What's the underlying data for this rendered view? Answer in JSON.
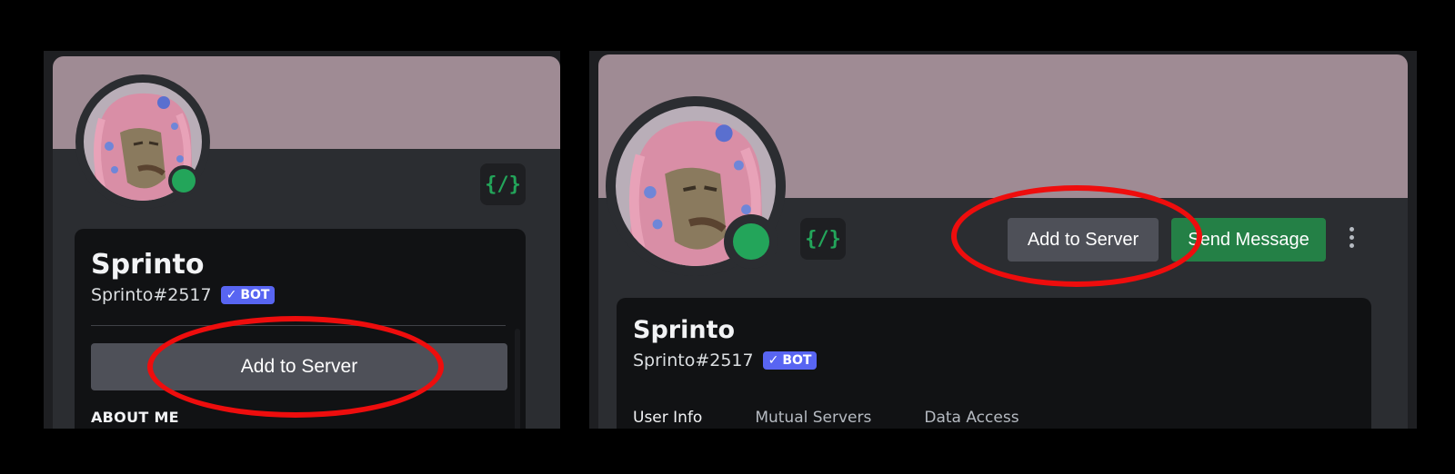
{
  "left": {
    "name": "Sprinto",
    "tag": "Sprinto#2517",
    "bot_badge": "BOT",
    "check": "✓",
    "add_to_server": "Add to Server",
    "about_me": "ABOUT ME",
    "cmd_badge": "{/}"
  },
  "right": {
    "name": "Sprinto",
    "tag": "Sprinto#2517",
    "bot_badge": "BOT",
    "check": "✓",
    "add_to_server": "Add to Server",
    "send_message": "Send Message",
    "cmd_badge": "{/}",
    "tabs": [
      "User Info",
      "Mutual Servers",
      "Data Access"
    ]
  },
  "colors": {
    "banner": "#9f8b94",
    "card": "#2b2d31",
    "inner": "#111214",
    "status_online": "#23a55a",
    "bot_badge": "#5865f2",
    "send_button": "#248046",
    "annotation": "#ee0d0d"
  },
  "icons": [
    "slash-command-icon",
    "check-icon",
    "kebab-menu-icon",
    "online-status-icon",
    "avatar-image"
  ]
}
